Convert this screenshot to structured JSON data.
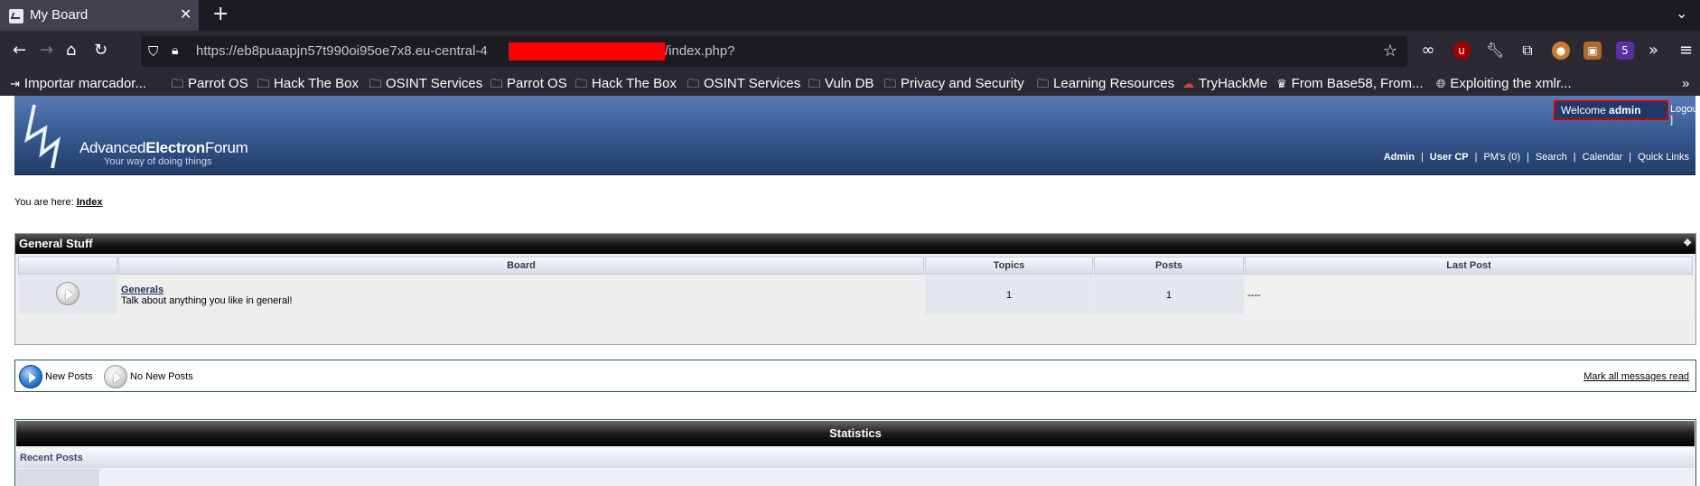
{
  "browser": {
    "tab_title": "My Board",
    "url_visible_start": "https://eb8puaapjn57t990oi95oe7x8.eu-central-4",
    "url_visible_end": "/index.php?",
    "bookmarks": [
      {
        "label": "Importar marcador...",
        "icon": "import-icon"
      },
      {
        "label": "Parrot OS",
        "icon": "folder-icon"
      },
      {
        "label": "Hack The Box",
        "icon": "folder-icon"
      },
      {
        "label": "OSINT Services",
        "icon": "folder-icon"
      },
      {
        "label": "Parrot OS",
        "icon": "folder-icon"
      },
      {
        "label": "Hack The Box",
        "icon": "folder-icon"
      },
      {
        "label": "OSINT Services",
        "icon": "folder-icon"
      },
      {
        "label": "Vuln DB",
        "icon": "folder-icon"
      },
      {
        "label": "Privacy and Security",
        "icon": "folder-icon"
      },
      {
        "label": "Learning Resources",
        "icon": "folder-icon"
      },
      {
        "label": "TryHackMe",
        "icon": "tryhackme-icon"
      },
      {
        "label": "From Base58, From...",
        "icon": "cyberchef-icon"
      },
      {
        "label": "Exploiting the xmlr...",
        "icon": "globe-icon"
      }
    ],
    "extension_badge": "5"
  },
  "forum": {
    "logo_word_1": "Advanced",
    "logo_word_2": "Electron",
    "logo_word_3": "Forum",
    "tagline": "Your way of doing things",
    "welcome_prefix": "Welcome",
    "welcome_user": "admin",
    "logout": "Logout",
    "logout_bracket": "]",
    "nav": {
      "admin": "Admin",
      "usercp": "User CP",
      "pms": "PM's (0)",
      "search": "Search",
      "calendar": "Calendar",
      "quicklinks": "Quick Links"
    },
    "sep": "|",
    "breadcrumb_prefix": "You are here:",
    "breadcrumb_link": "Index",
    "category": {
      "title": "General Stuff",
      "columns": {
        "board": "Board",
        "topics": "Topics",
        "posts": "Posts",
        "last_post": "Last Post"
      },
      "boards": [
        {
          "name": "Generals",
          "description": "Talk about anything you like in general!",
          "topics": "1",
          "posts": "1",
          "last_post": "----"
        }
      ]
    },
    "legend": {
      "new_posts": "New Posts",
      "no_new_posts": "No New Posts",
      "mark_all": "Mark all messages read"
    },
    "stats": {
      "title": "Statistics",
      "recent_posts": "Recent Posts"
    }
  },
  "colors": {
    "header_top": "#577bb8",
    "header_bottom": "#213c68",
    "highlight_border": "#d00000",
    "redaction": "#ff0000"
  }
}
